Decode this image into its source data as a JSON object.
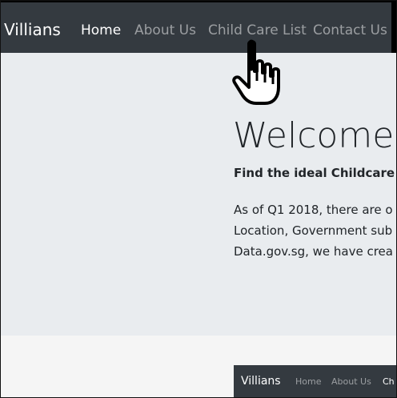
{
  "navbar": {
    "brand": "Villians",
    "links": [
      "Home",
      "About Us",
      "Child Care List",
      "Contact Us"
    ],
    "active": "Home"
  },
  "hero": {
    "heading": "Welcome t",
    "lead": "Find the ideal Childcare",
    "paragraph_lines": [
      "As of Q1 2018, there are o",
      "Location, Government sub",
      "Data.gov.sg, we have crea"
    ]
  },
  "mini_navbar": {
    "brand": "Villians",
    "links": [
      "Home",
      "About Us",
      "Ch"
    ]
  },
  "cursor": {
    "icon": "hand-pointer-icon"
  },
  "colors": {
    "navbar_bg": "#343a40",
    "jumbotron_bg": "#e9ecef",
    "text": "#212529"
  }
}
